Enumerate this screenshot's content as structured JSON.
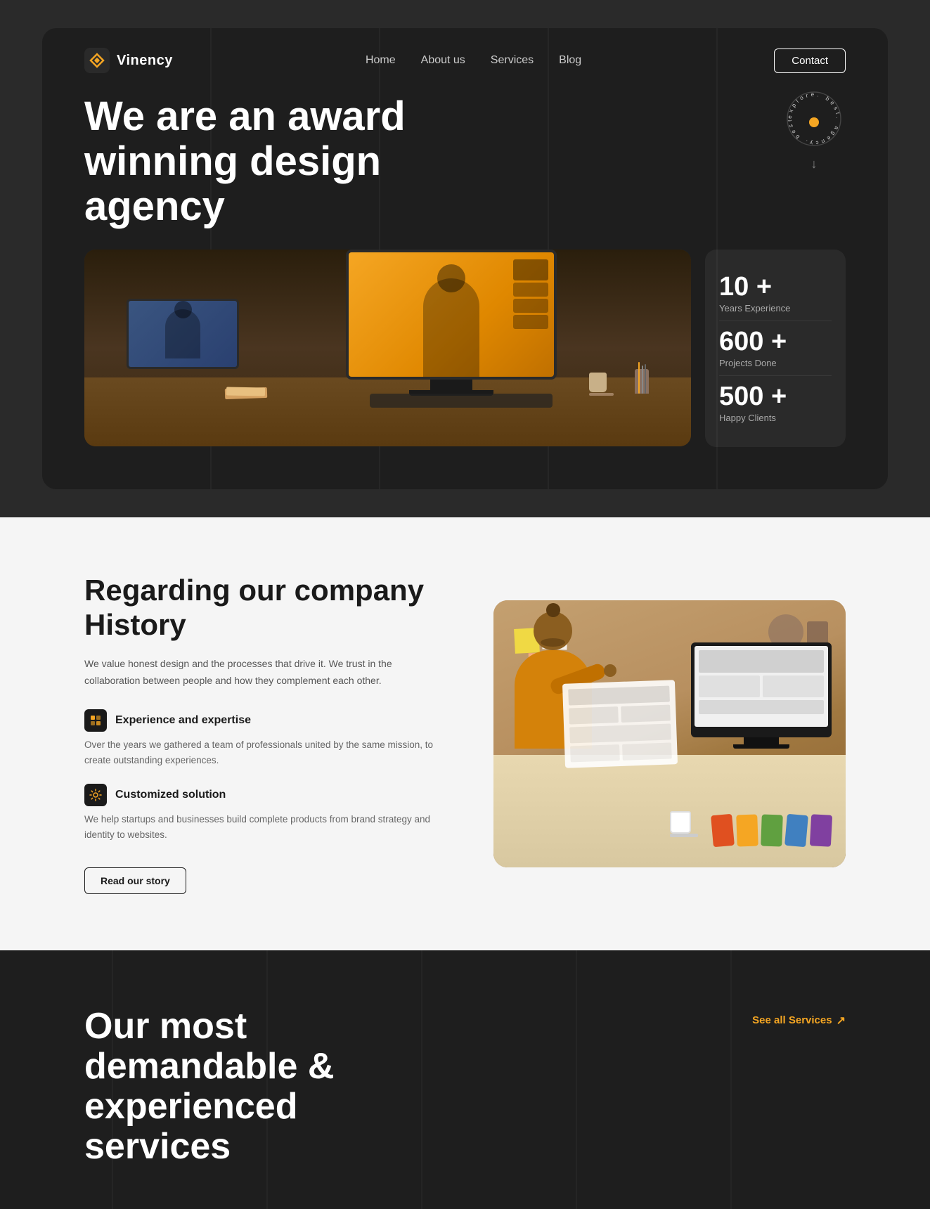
{
  "site": {
    "name": "Vinency"
  },
  "navbar": {
    "logo_text": "Vinency",
    "links": [
      {
        "label": "Home",
        "href": "#"
      },
      {
        "label": "About us",
        "href": "#"
      },
      {
        "label": "Services",
        "href": "#"
      },
      {
        "label": "Blog",
        "href": "#"
      }
    ],
    "contact_label": "Contact"
  },
  "hero": {
    "title": "We are an award winning design agency",
    "badge_text": "explore. best. agency. best.",
    "stats": [
      {
        "number": "10 +",
        "label": "Years Experience"
      },
      {
        "number": "600 +",
        "label": "Projects Done"
      },
      {
        "number": "500 +",
        "label": "Happy Clients"
      }
    ]
  },
  "about": {
    "title": "Regarding our company History",
    "description": "We value honest design and the processes that drive it. We trust in the collaboration between people and how they complement each other.",
    "features": [
      {
        "icon": "⚡",
        "title": "Experience and expertise",
        "description": "Over the years we gathered a team of professionals united by the same mission, to create outstanding experiences."
      },
      {
        "icon": "⚙",
        "title": "Customized solution",
        "description": "We help startups and businesses build complete products from brand strategy and identity to websites."
      }
    ],
    "button_label": "Read our story"
  },
  "services": {
    "title": "Our most demandable & experienced services",
    "see_all_label": "See all Services",
    "see_all_arrow": "↗"
  },
  "colors": {
    "accent": "#f5a623",
    "dark_bg": "#1e1e1e",
    "light_bg": "#f5f5f5",
    "text_dark": "#1a1a1a",
    "text_light": "#ffffff",
    "text_muted": "#aaaaaa"
  }
}
